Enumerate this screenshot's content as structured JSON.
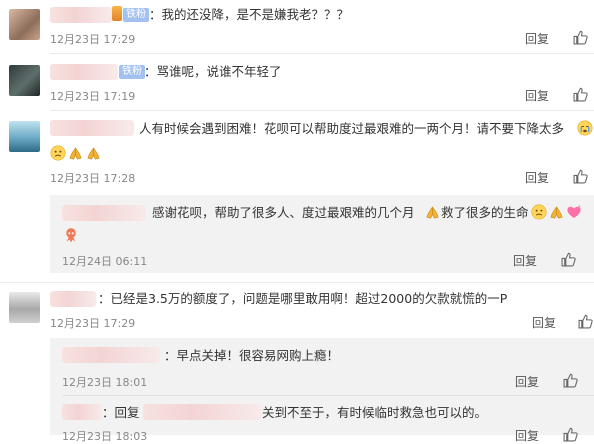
{
  "comments": [
    {
      "text": "：我的还没降，是不是嫌我老？？？",
      "badge": "铁粉",
      "time": "12月23日 17:29",
      "reply": "回复"
    },
    {
      "text": "：骂谁呢，说谁不年轻了",
      "badge": "铁粉",
      "time": "12月23日 17:19",
      "reply": "回复"
    },
    {
      "text": "人有时候会遇到困难！花呗可以帮助度过最艰难的一两个月！请不要下降太多",
      "time": "12月23日 17:28",
      "reply": "回复"
    },
    {
      "text": "：已经是3.5万的额度了，问题是哪里敢用啊！超过2000的欠款就慌的一P",
      "time": "12月23日 17:29",
      "reply": "回复"
    }
  ],
  "replies": [
    {
      "text": "感谢花呗，帮助了很多人、度过最艰难的几个月",
      "text2": "救了很多的生命",
      "time": "12月24日 06:11",
      "reply": "回复"
    },
    {
      "text": "：早点关掉！很容易网购上瘾！",
      "time": "12月23日 18:01",
      "reply": "回复"
    },
    {
      "text_prefix": "：回复",
      "text": "关到不至于，有时候临时救急也可以的。",
      "time": "12月23日 18:03",
      "reply": "回复"
    }
  ]
}
